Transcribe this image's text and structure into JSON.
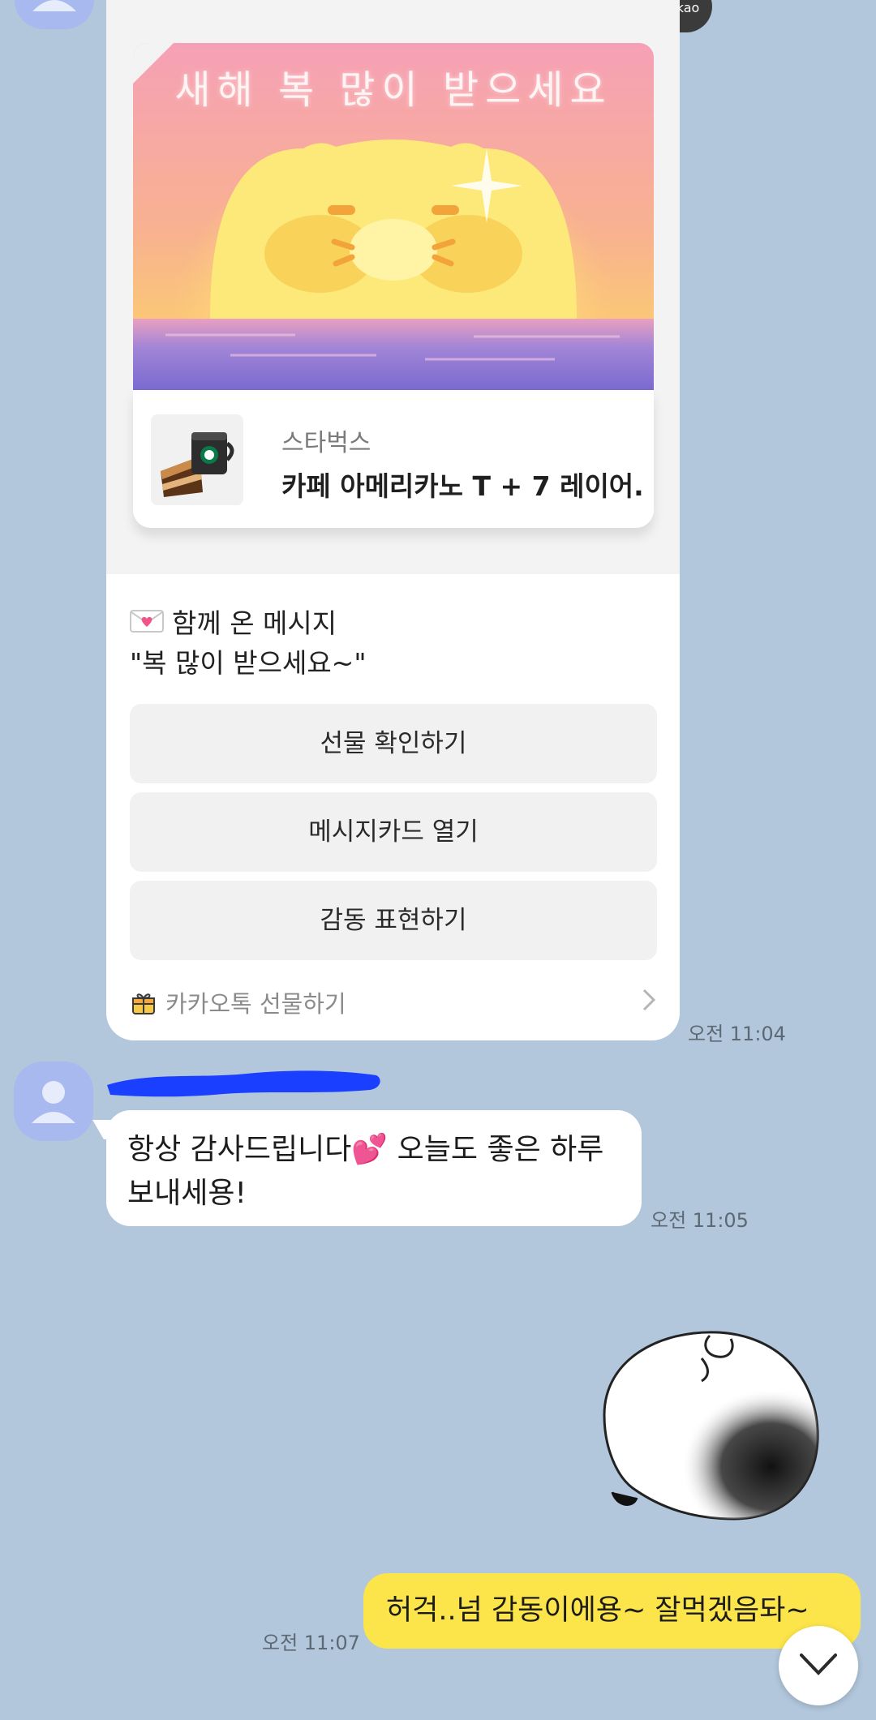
{
  "badge": {
    "label": "Kakao"
  },
  "gift_card": {
    "headline": "새해 복 많이 받으세요",
    "product_brand": "스타벅스",
    "product_name": "카페 아메리카노 T + 7 레이어.",
    "message_label": "함께 온 메시지",
    "message_text": "\"복 많이 받으세요~\"",
    "buttons": [
      "선물 확인하기",
      "메시지카드 열기",
      "감동 표현하기"
    ],
    "footer_label": "카카오톡 선물하기",
    "time": "오전 11:04"
  },
  "incoming": {
    "line1": "항상 감사드립니다💕 오늘도 좋은 하루",
    "line2": "보내세용!",
    "time": "오전 11:05"
  },
  "outgoing": {
    "text": "허걱..넘 감동이에용~  잘먹겠음돠~",
    "time": "오전 11:07"
  },
  "colors": {
    "background": "#b2c7dc",
    "outgoing_bubble": "#fce54a",
    "avatar": "#a7b9ef",
    "redaction": "#1a3fff"
  },
  "icons": {
    "avatar": "person-icon",
    "message": "envelope-heart-icon",
    "gift_footer": "gift-box-icon",
    "footer_chevron": "chevron-right-icon",
    "scroll": "chevron-down-icon"
  }
}
